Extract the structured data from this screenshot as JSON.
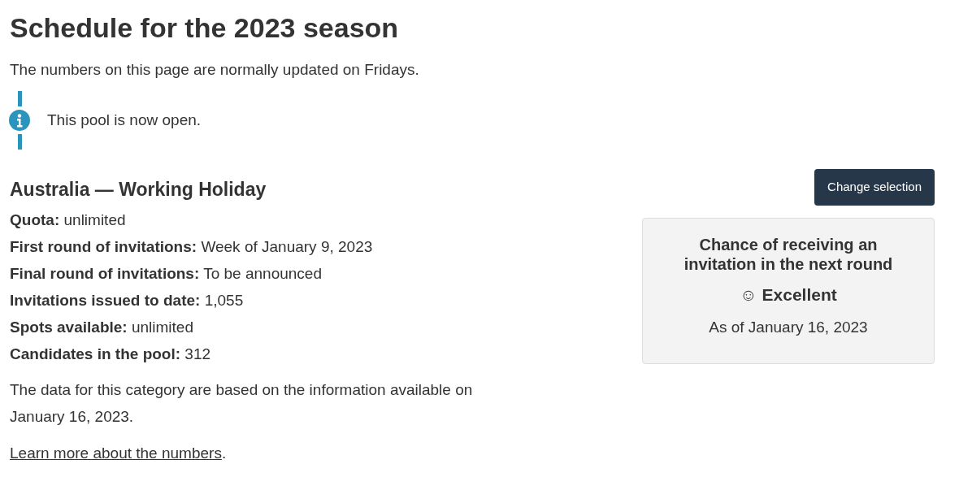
{
  "page_title": "Schedule for the 2023 season",
  "intro": "The numbers on this page are normally updated on Fridays.",
  "alert": {
    "kind": "info",
    "text": "This pool is now open."
  },
  "category": {
    "title": "Australia — Working Holiday",
    "facts": [
      "**Quota:** unlimited",
      "**First round of invitations:** Week of January 9, 2023",
      "**Final round of invitations:** To be announced",
      "**Invitations issued to date:** 1,055",
      "**Spots available:** unlimited",
      "**Candidates in the pool:** 312"
    ],
    "note": "The data for this category are based on the information available on January 16, 2023.",
    "link": "Learn more about the numbers",
    "link_suffix": "."
  },
  "change_button": "Change selection",
  "chance_card": {
    "title": "Chance of receiving an invitation in the next round",
    "rating": "☺ Excellent",
    "as_of": "As of January 16, 2023"
  }
}
